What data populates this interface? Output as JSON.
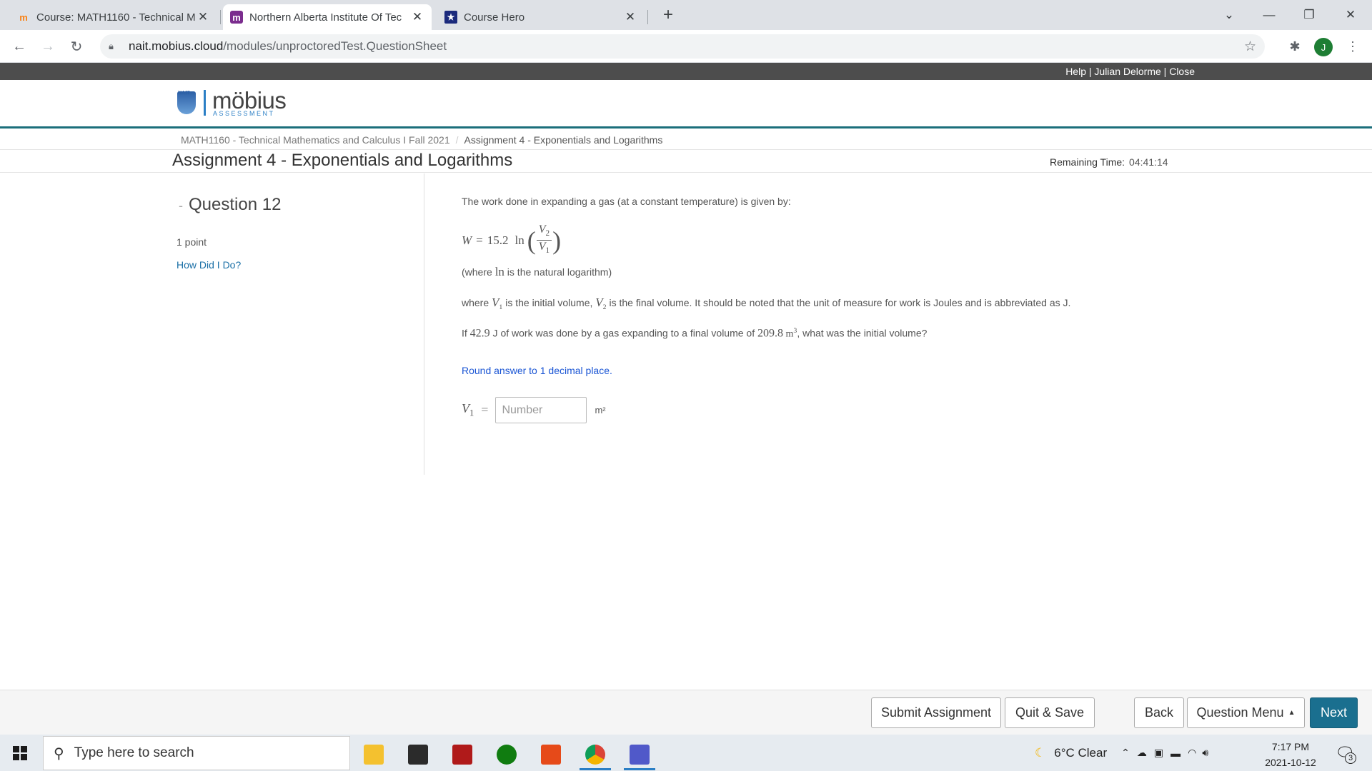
{
  "browser": {
    "tabs": [
      {
        "title": "Course: MATH1160 - Technical M",
        "favicon": "moodle-icon",
        "active": false
      },
      {
        "title": "Northern Alberta Institute Of Tec",
        "favicon": "mobius-m-icon",
        "active": true
      },
      {
        "title": "Course Hero",
        "favicon": "coursehero-star-icon",
        "active": false
      }
    ],
    "url_host": "nait.mobius.cloud",
    "url_path": "/modules/unproctoredTest.QuestionSheet",
    "profile_initial": "J"
  },
  "topbar": {
    "help": "Help",
    "user": "Julian Delorme",
    "close": "Close",
    "sep": " | "
  },
  "logo": {
    "nait_label": "NAIT",
    "name": "möbius",
    "sub": "ASSESSMENT"
  },
  "breadcrumb": {
    "course": "MATH1160 - Technical Mathematics and Calculus I Fall 2021",
    "separator": "/",
    "current": "Assignment 4 - Exponentials and Logarithms"
  },
  "assignment": {
    "title": "Assignment 4 - Exponentials and Logarithms",
    "remaining_label": "Remaining Time:",
    "remaining_value": "04:41:14"
  },
  "question": {
    "dash": "-",
    "heading": "Question 12",
    "points": "1 point",
    "how_did_i_do": "How Did I Do?",
    "intro": "The work done in expanding a gas (at a constant temperature) is given by:",
    "formula": {
      "lhs": "W",
      "eq": "=",
      "coef": "15.2",
      "fn": "ln",
      "num_var": "V",
      "num_sub": "2",
      "den_var": "V",
      "den_sub": "1"
    },
    "ln_note_before": "(where ",
    "ln_note_fn": "ln",
    "ln_note_after": " is the natural logarithm)",
    "where_1": "where ",
    "v1": "V",
    "v1_sub": "1",
    "where_2": " is the initial volume, ",
    "v2": "V",
    "v2_sub": "2",
    "where_3": " is the final volume. It should be noted that the unit of measure for work is Joules and is abbreviated as J.",
    "if_1": "If ",
    "work_value": "42.9",
    "if_2": " J of work was done by a gas expanding to a final volume of ",
    "volume_value": "209.8",
    "volume_unit": " m",
    "volume_exp": "3",
    "if_3": ", what was the initial volume?",
    "round_note": "Round answer to 1 decimal place.",
    "answer_var": "V",
    "answer_sub": "1",
    "answer_eq": "=",
    "answer_placeholder": "Number",
    "answer_value": "",
    "answer_unit": "m²"
  },
  "actions": {
    "submit": "Submit Assignment",
    "quit_save": "Quit & Save",
    "back": "Back",
    "question_menu": "Question Menu",
    "next": "Next"
  },
  "taskbar": {
    "search_placeholder": "Type here to search",
    "apps": [
      "file-explorer-icon",
      "store-icon",
      "app-red-icon",
      "xbox-icon",
      "office-icon",
      "chrome-icon",
      "teams-icon"
    ],
    "weather": "6°C  Clear",
    "time": "7:17 PM",
    "date": "2021-10-12",
    "notifications": "3"
  },
  "colors": {
    "accent_teal": "#1b6f7b",
    "next_button": "#1a6f8f",
    "link_blue": "#1a6fa6",
    "round_note": "#1a55d4"
  }
}
